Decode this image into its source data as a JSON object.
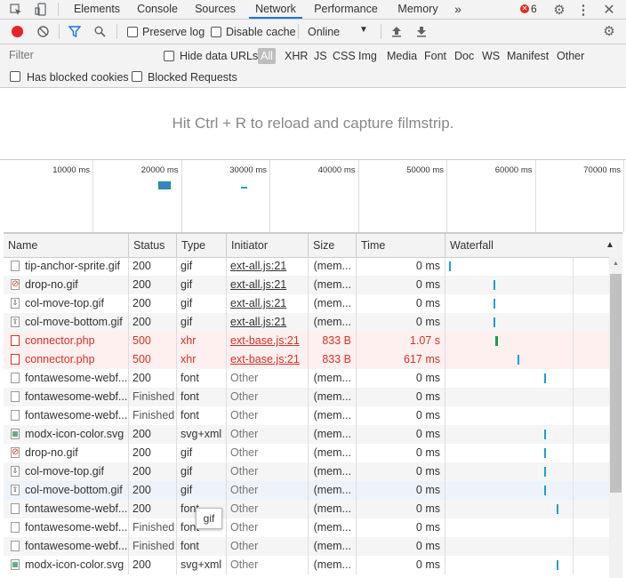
{
  "tabs": [
    "Elements",
    "Console",
    "Sources",
    "Network",
    "Performance",
    "Memory"
  ],
  "active_tab": "Network",
  "more_tabs_label": "»",
  "error_count": "6",
  "toolbar": {
    "preserve_log": "Preserve log",
    "disable_cache": "Disable cache",
    "throttle_value": "Online"
  },
  "filter": {
    "placeholder": "Filter",
    "hide_data_urls": "Hide data URLs",
    "types": [
      "All",
      "XHR",
      "JS",
      "CSS",
      "Img",
      "Media",
      "Font",
      "Doc",
      "WS",
      "Manifest",
      "Other"
    ],
    "has_blocked_cookies": "Has blocked cookies",
    "blocked_requests": "Blocked Requests"
  },
  "filmstrip_message": "Hit Ctrl + R to reload and capture filmstrip.",
  "overview_ticks": [
    "10000 ms",
    "20000 ms",
    "30000 ms",
    "40000 ms",
    "50000 ms",
    "60000 ms",
    "70000 ms"
  ],
  "columns": {
    "name": "Name",
    "status": "Status",
    "type": "Type",
    "initiator": "Initiator",
    "size": "Size",
    "time": "Time",
    "waterfall": "Waterfall"
  },
  "rows": [
    {
      "name": "tip-anchor-sprite.gif",
      "status": "200",
      "type": "gif",
      "initiator": "ext-all.js:21",
      "size": "(mem...",
      "time": "0 ms",
      "icon": "image-file-icon",
      "wf": 0.0
    },
    {
      "name": "drop-no.gif",
      "status": "200",
      "type": "gif",
      "initiator": "ext-all.js:21",
      "size": "(mem...",
      "time": "0 ms",
      "icon": "no-entry-icon",
      "wf": 0.27
    },
    {
      "name": "col-move-top.gif",
      "status": "200",
      "type": "gif",
      "initiator": "ext-all.js:21",
      "size": "(mem...",
      "time": "0 ms",
      "icon": "arrow-down-file-icon",
      "wf": 0.27
    },
    {
      "name": "col-move-bottom.gif",
      "status": "200",
      "type": "gif",
      "initiator": "ext-all.js:21",
      "size": "(mem...",
      "time": "0 ms",
      "icon": "arrow-up-file-icon",
      "wf": 0.27
    },
    {
      "name": "connector.php",
      "status": "500",
      "type": "xhr",
      "initiator": "ext-base.js:21",
      "size": "833 B",
      "time": "1.07 s",
      "icon": "document-file-icon",
      "wf": 0.28,
      "error": true
    },
    {
      "name": "connector.php",
      "status": "500",
      "type": "xhr",
      "initiator": "ext-base.js:21",
      "size": "833 B",
      "time": "617 ms",
      "icon": "document-file-icon",
      "wf": 0.42,
      "error": true
    },
    {
      "name": "fontawesome-webf...",
      "status": "200",
      "type": "font",
      "initiator": "Other",
      "size": "(mem...",
      "time": "0 ms",
      "icon": "document-file-icon",
      "wf": 0.58
    },
    {
      "name": "fontawesome-webf...",
      "status": "Finished",
      "type": "font",
      "initiator": "Other",
      "size": "(mem...",
      "time": "0 ms",
      "icon": "document-file-icon",
      "wf": null
    },
    {
      "name": "fontawesome-webf...",
      "status": "Finished",
      "type": "font",
      "initiator": "Other",
      "size": "(mem...",
      "time": "0 ms",
      "icon": "document-file-icon",
      "wf": null
    },
    {
      "name": "modx-icon-color.svg",
      "status": "200",
      "type": "svg+xml",
      "initiator": "Other",
      "size": "(mem...",
      "time": "0 ms",
      "icon": "svg-image-icon",
      "wf": 0.58
    },
    {
      "name": "drop-no.gif",
      "status": "200",
      "type": "gif",
      "initiator": "Other",
      "size": "(mem...",
      "time": "0 ms",
      "icon": "no-entry-icon",
      "wf": 0.58
    },
    {
      "name": "col-move-top.gif",
      "status": "200",
      "type": "gif",
      "initiator": "Other",
      "size": "(mem...",
      "time": "0 ms",
      "icon": "arrow-down-file-icon",
      "wf": 0.58
    },
    {
      "name": "col-move-bottom.gif",
      "status": "200",
      "type": "gif",
      "initiator": "Other",
      "size": "(mem...",
      "time": "0 ms",
      "icon": "arrow-up-file-icon",
      "wf": 0.58
    },
    {
      "name": "fontawesome-webf...",
      "status": "200",
      "type": "font",
      "initiator": "Other",
      "size": "(mem...",
      "time": "0 ms",
      "icon": "document-file-icon",
      "wf": 0.66
    },
    {
      "name": "fontawesome-webf...",
      "status": "Finished",
      "type": "font",
      "initiator": "Other",
      "size": "(mem...",
      "time": "0 ms",
      "icon": "document-file-icon",
      "wf": null
    },
    {
      "name": "fontawesome-webf...",
      "status": "Finished",
      "type": "font",
      "initiator": "Other",
      "size": "(mem...",
      "time": "0 ms",
      "icon": "document-file-icon",
      "wf": null
    },
    {
      "name": "modx-icon-color.svg",
      "status": "200",
      "type": "svg+xml",
      "initiator": "Other",
      "size": "(mem...",
      "time": "0 ms",
      "icon": "svg-image-icon",
      "wf": 0.66
    }
  ],
  "tooltip": "gif",
  "colors": {
    "accent": "#1a73e8",
    "error": "#d93025",
    "record": "#e8232a",
    "waterfall": "#1a9fd6"
  }
}
